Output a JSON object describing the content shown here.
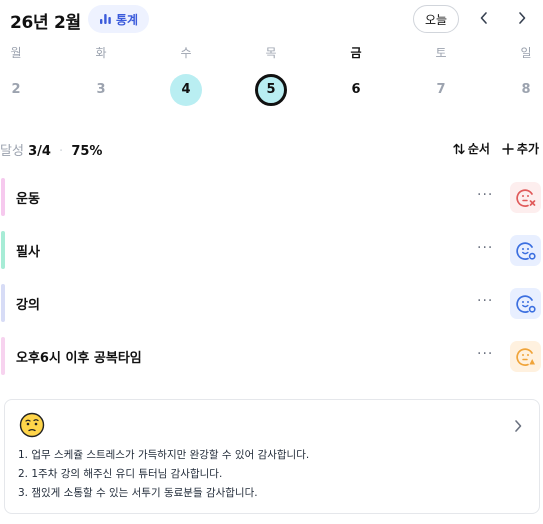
{
  "header": {
    "month": "26년 2월",
    "stats_label": "통계",
    "today_label": "오늘",
    "accent": "#3b5bdb"
  },
  "week": {
    "days": [
      {
        "weekday": "월",
        "date": "2"
      },
      {
        "weekday": "화",
        "date": "3"
      },
      {
        "weekday": "수",
        "date": "4"
      },
      {
        "weekday": "목",
        "date": "5"
      },
      {
        "weekday": "금",
        "date": "6"
      },
      {
        "weekday": "토",
        "date": "7"
      },
      {
        "weekday": "일",
        "date": "8"
      }
    ],
    "completed_color": "#b9eef2"
  },
  "summary": {
    "label": "달성",
    "count": "3/4",
    "percent": "75%"
  },
  "tools": {
    "order_label": "순서",
    "add_label": "추가"
  },
  "habits": [
    {
      "title": "운동",
      "bar_color": "#f6c9ee",
      "status": "missed",
      "status_icon": "face-x-icon"
    },
    {
      "title": "필사",
      "bar_color": "#a7ecd6",
      "status": "done",
      "status_icon": "face-check-icon"
    },
    {
      "title": "강의",
      "bar_color": "#d7dcf6",
      "status": "done",
      "status_icon": "face-check-icon"
    },
    {
      "title": "오후6시 이후 공복타임",
      "bar_color": "#f7d3ef",
      "status": "partial",
      "status_icon": "face-warn-icon"
    }
  ],
  "more_label": "···",
  "journal": {
    "mood_icon": "thinking-face-icon",
    "lines": [
      "1. 업무 스케쥴 스트레스가 가득하지만 완강할 수 있어 감사합니다.",
      "2. 1주차 강의 해주신 유디 튜터님 감사합니다.",
      "3. 잼있게 소통할 수 있는 서투기 동료분들 감사합니다."
    ]
  }
}
